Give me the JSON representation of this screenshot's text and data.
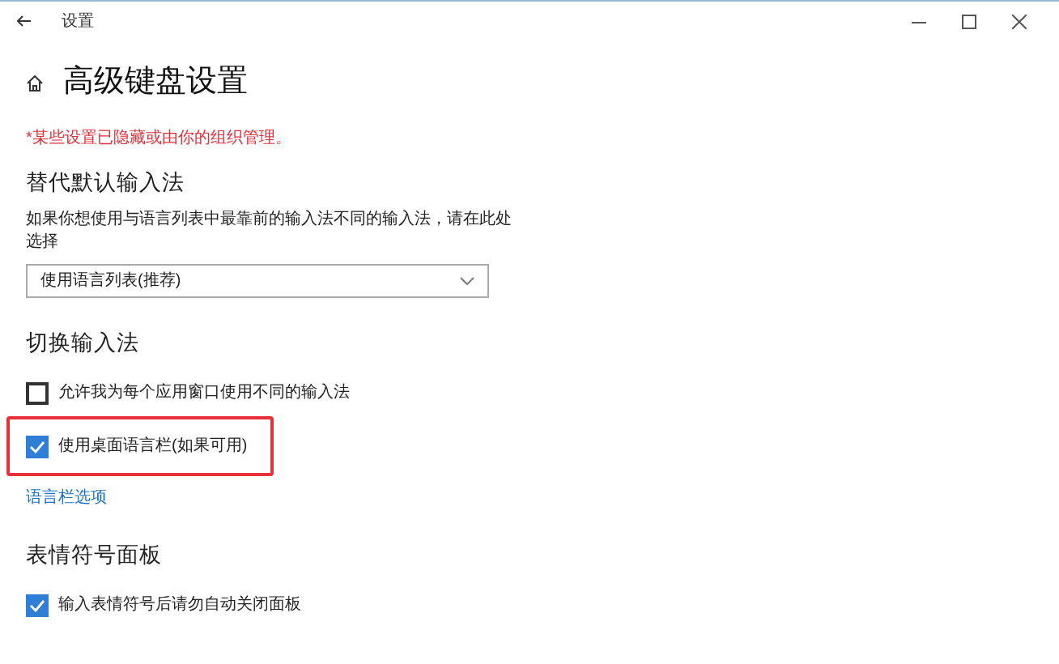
{
  "window": {
    "title": "设置"
  },
  "page": {
    "title": "高级键盘设置"
  },
  "notice": "*某些设置已隐藏或由你的组织管理。",
  "sections": [
    {
      "heading": "替代默认输入法",
      "items": [
        {
          "kind": "text",
          "text": "如果你想使用与语言列表中最靠前的输入法不同的输入法，请在此处选择"
        },
        {
          "kind": "dropdown",
          "value": "使用语言列表(推荐)"
        }
      ]
    },
    {
      "heading": "切换输入法",
      "items": [
        {
          "kind": "checkbox",
          "label": "允许我为每个应用窗口使用不同的输入法",
          "checked": false,
          "highlighted": false
        },
        {
          "kind": "checkbox",
          "label": "使用桌面语言栏(如果可用)",
          "checked": true,
          "highlighted": true
        },
        {
          "kind": "link",
          "text": "语言栏选项"
        }
      ]
    },
    {
      "heading": "表情符号面板",
      "items": [
        {
          "kind": "checkbox",
          "label": "输入表情符号后请勿自动关闭面板",
          "checked": true,
          "highlighted": false
        }
      ]
    }
  ]
}
